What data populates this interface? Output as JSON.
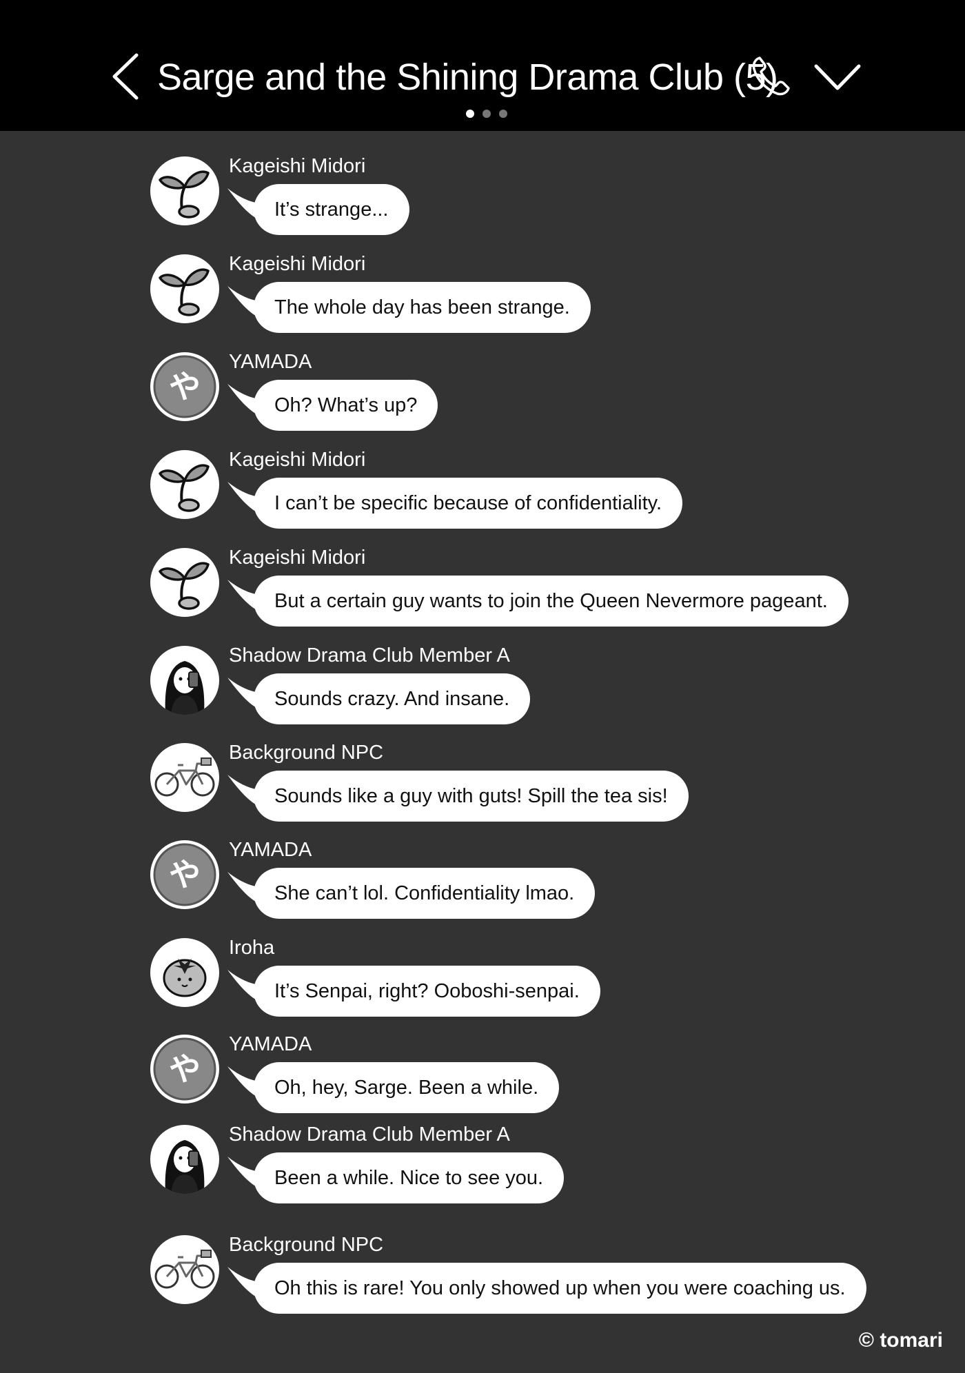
{
  "header": {
    "title": "Sarge and the Shining Drama Club (5)",
    "back_icon": "chevron-left-icon",
    "call_icon": "phone-icon",
    "menu_icon": "chevron-down-icon",
    "page_dots": 3,
    "active_dot": 0
  },
  "messages": [
    {
      "sender": "Kageishi Midori",
      "avatar": "sprout",
      "text": "It’s strange..."
    },
    {
      "sender": "Kageishi Midori",
      "avatar": "sprout",
      "text": "The whole day has been strange."
    },
    {
      "sender": "YAMADA",
      "avatar": "ya",
      "text": "Oh? What’s up?"
    },
    {
      "sender": "Kageishi Midori",
      "avatar": "sprout",
      "text": "I can’t be specific because of confidentiality."
    },
    {
      "sender": "Kageishi Midori",
      "avatar": "sprout",
      "text": "But a certain guy wants to join the Queen Nevermore pageant."
    },
    {
      "sender": "Shadow Drama Club Member A",
      "avatar": "girl",
      "text": "Sounds crazy. And insane."
    },
    {
      "sender": "Background NPC",
      "avatar": "bicycle",
      "text": "Sounds like a guy with guts! Spill the tea sis!"
    },
    {
      "sender": "YAMADA",
      "avatar": "ya",
      "text": "She can’t lol. Confidentiality lmao."
    },
    {
      "sender": "Iroha",
      "avatar": "tomato",
      "text": "It’s Senpai, right? Ooboshi-senpai."
    },
    {
      "sender": "YAMADA",
      "avatar": "ya",
      "text": "Oh, hey, Sarge. Been a while."
    },
    {
      "sender": "Shadow Drama Club Member A",
      "avatar": "girl",
      "text": "Been a while. Nice to see you."
    },
    {
      "sender": "Background NPC",
      "avatar": "bicycle",
      "text": "Oh this is rare! You only showed up when you were coaching us."
    }
  ],
  "credit": "© tomari"
}
